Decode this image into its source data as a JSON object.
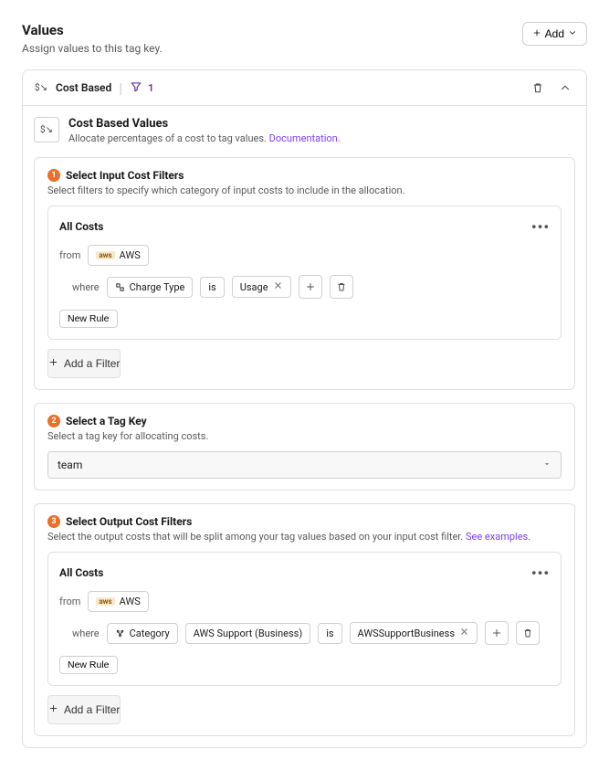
{
  "header": {
    "title": "Values",
    "subtitle": "Assign values to this tag key.",
    "add_label": "Add"
  },
  "card": {
    "type_label": "Cost Based",
    "filter_count": "1",
    "lead_title": "Cost Based Values",
    "lead_sub_text": "Allocate percentages of a cost to tag values. ",
    "lead_sub_link": "Documentation."
  },
  "step1": {
    "num": "1",
    "title": "Select Input Cost Filters",
    "sub": "Select filters to specify which category of input costs to include in the allocation.",
    "filter_title": "All Costs",
    "from_kw": "from",
    "provider": "AWS",
    "where_kw": "where",
    "dim_label": "Charge Type",
    "op": "is",
    "value": "Usage",
    "new_rule": "New Rule",
    "add_filter": "Add a Filter"
  },
  "step2": {
    "num": "2",
    "title": "Select a Tag Key",
    "sub": "Select a tag key for allocating costs.",
    "value": "team"
  },
  "step3": {
    "num": "3",
    "title": "Select Output Cost Filters",
    "sub_text": "Select the output costs that will be split among your tag values based on your input cost filter. ",
    "sub_link": "See examples.",
    "filter_title": "All Costs",
    "from_kw": "from",
    "provider": "AWS",
    "where_kw": "where",
    "dim_label": "Category",
    "dim_detail": "AWS Support (Business)",
    "op": "is",
    "value": "AWSSupportBusiness",
    "new_rule": "New Rule",
    "add_filter": "Add a Filter"
  }
}
